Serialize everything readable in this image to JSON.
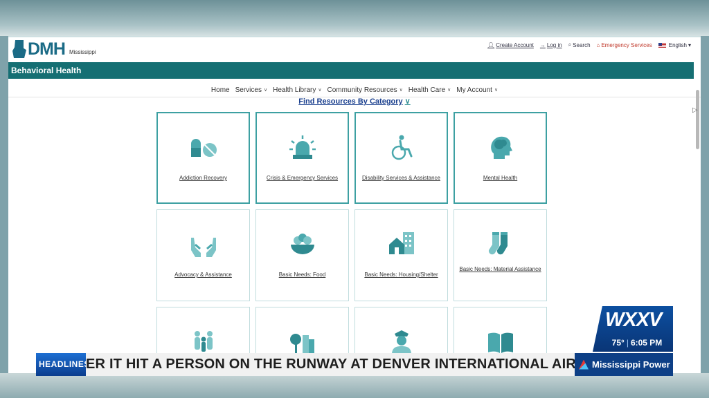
{
  "header": {
    "logo_text": "DMH",
    "logo_state": "Mississippi",
    "links": {
      "create_account": "Create Account",
      "log_in": "Log in",
      "search": "Search",
      "emergency": "Emergency Services",
      "language": "English"
    }
  },
  "section_title": "Behavioral Health",
  "nav": {
    "home": "Home",
    "services": "Services",
    "health_library": "Health Library",
    "community_resources": "Community Resources",
    "health_care": "Health Care",
    "my_account": "My Account"
  },
  "find_resources": "Find Resources By Category",
  "categories": [
    {
      "label": "Addiction Recovery",
      "icon": "pills-icon"
    },
    {
      "label": "Crisis & Emergency Services",
      "icon": "siren-icon"
    },
    {
      "label": "Disability Services & Assistance",
      "icon": "wheelchair-icon"
    },
    {
      "label": "Mental Health",
      "icon": "brain-head-icon"
    },
    {
      "label": "Advocacy & Assistance",
      "icon": "helping-hands-icon"
    },
    {
      "label": "Basic Needs: Food",
      "icon": "food-bowl-icon"
    },
    {
      "label": "Basic Needs: Housing/Shelter",
      "icon": "house-icon"
    },
    {
      "label": "Basic Needs: Material Assistance",
      "icon": "socks-icon"
    },
    {
      "label": "",
      "icon": "family-icon"
    },
    {
      "label": "",
      "icon": "city-park-icon"
    },
    {
      "label": "",
      "icon": "police-officer-icon"
    },
    {
      "label": "",
      "icon": "book-icon"
    }
  ],
  "broadcast": {
    "station": "WXXV",
    "temperature": "75°",
    "time": "6:05 PM",
    "headlines_label": "HEADLINES",
    "ticker_text": "ER IT HIT A PERSON ON THE RUNWAY AT DENVER INTERNATIONAL AIRPORT",
    "sponsor": "Mississippi Power"
  },
  "colors": {
    "teal": "#156f73",
    "card_border": "#3da0a2",
    "icon_teal": "#4aa8ad",
    "station_blue": "#0c4fa0"
  }
}
